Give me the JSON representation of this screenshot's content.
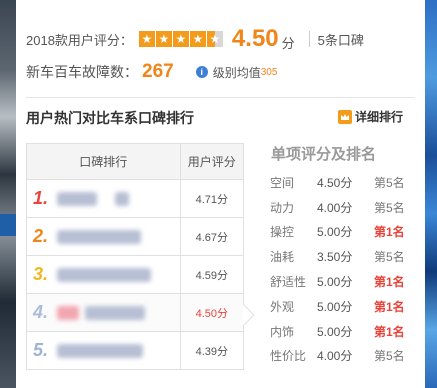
{
  "rating": {
    "label": "2018款用户评分：",
    "stars": 4.5,
    "score": "4.50",
    "unit": "分",
    "reviews": "5条口碑"
  },
  "fault": {
    "label": "新车百车故障数：",
    "value": "267",
    "avg_label": "级别均值",
    "avg_value": "305"
  },
  "section": {
    "title": "用户热门对比车系口碑排行",
    "detail_link": "详细排行"
  },
  "ranking": {
    "header_name": "口碑排行",
    "header_score": "用户评分",
    "rows": [
      {
        "rank": "1.",
        "score": "4.71分"
      },
      {
        "rank": "2.",
        "score": "4.67分"
      },
      {
        "rank": "3.",
        "score": "4.59分"
      },
      {
        "rank": "4.",
        "score": "4.50分"
      },
      {
        "rank": "5.",
        "score": "4.39分"
      }
    ]
  },
  "single": {
    "title": "单项评分及排名",
    "items": [
      {
        "name": "空间",
        "score": "4.50分",
        "rank": "第5名"
      },
      {
        "name": "动力",
        "score": "4.00分",
        "rank": "第5名"
      },
      {
        "name": "操控",
        "score": "5.00分",
        "rank": "第1名"
      },
      {
        "name": "油耗",
        "score": "3.50分",
        "rank": "第5名"
      },
      {
        "name": "舒适性",
        "score": "5.00分",
        "rank": "第1名"
      },
      {
        "name": "外观",
        "score": "5.00分",
        "rank": "第1名"
      },
      {
        "name": "内饰",
        "score": "5.00分",
        "rank": "第1名"
      },
      {
        "name": "性价比",
        "score": "4.00分",
        "rank": "第5名"
      }
    ]
  },
  "colors": {
    "accent": "#f08519",
    "highlight": "#e8443a",
    "info": "#3d7fd6"
  }
}
